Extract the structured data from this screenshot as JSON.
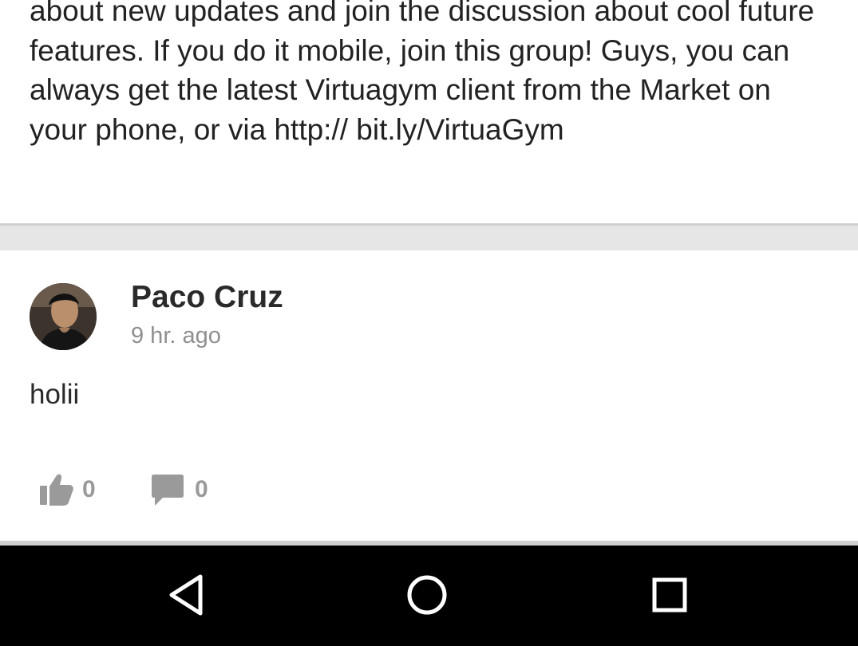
{
  "previous_post": {
    "text": "about new updates and join the discussion about cool future features. If you do it mobile, join this group! Guys, you can always get the latest Virtuagym client from the Market on your phone, or via http:// bit.ly/VirtuaGym"
  },
  "post": {
    "author": "Paco Cruz",
    "time": "9 hr. ago",
    "body": "holii",
    "likes": "0",
    "comments": "0"
  },
  "icons": {
    "like": "thumbs-up-icon",
    "comment": "comment-bubble-icon",
    "avatar": "user-avatar"
  },
  "navigation": {
    "back": "back-triangle-icon",
    "home": "home-circle-icon",
    "recents": "recents-square-icon"
  },
  "colors": {
    "text": "#222222",
    "muted": "#8f8f8f",
    "separator": "#e6e6e6",
    "nav_background": "#000000"
  }
}
